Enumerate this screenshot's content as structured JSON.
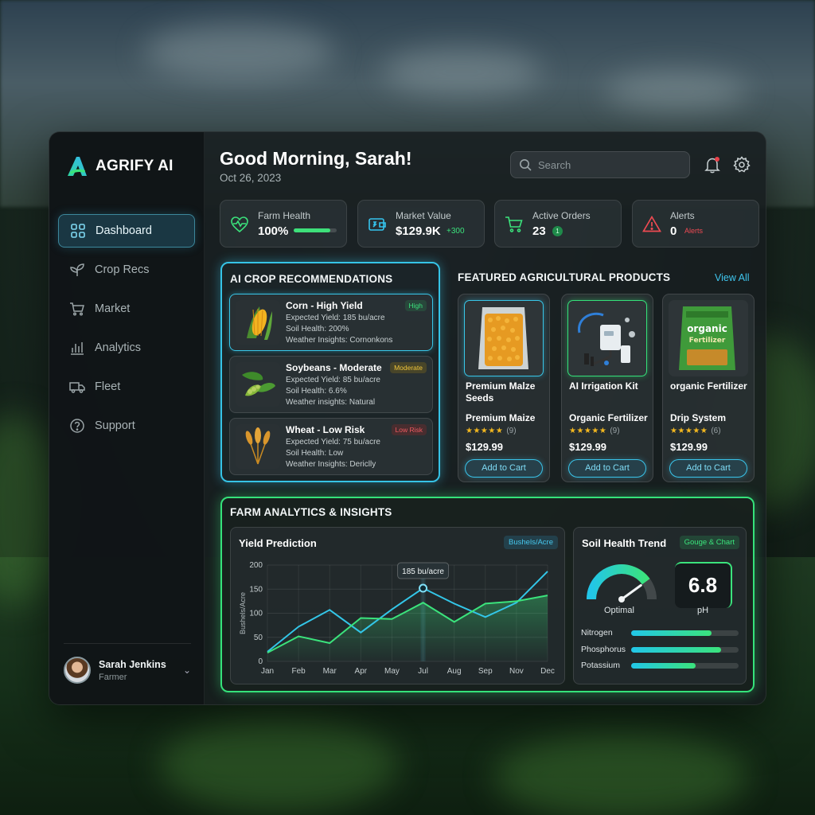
{
  "app": {
    "name": "AGRIFY AI"
  },
  "header": {
    "greeting": "Good Morning, Sarah!",
    "date": "Oct 26, 2023",
    "search_placeholder": "Search"
  },
  "sidebar": {
    "items": [
      {
        "label": "Dashboard",
        "icon": "grid-icon",
        "active": true
      },
      {
        "label": "Crop Recs",
        "icon": "sprout-icon"
      },
      {
        "label": "Market",
        "icon": "cart-icon"
      },
      {
        "label": "Analytics",
        "icon": "bar-chart-icon"
      },
      {
        "label": "Fleet",
        "icon": "truck-icon"
      },
      {
        "label": "Support",
        "icon": "help-icon"
      }
    ],
    "user": {
      "name": "Sarah Jenkins",
      "role": "Farmer"
    }
  },
  "stats": {
    "farm_health": {
      "label": "Farm Health",
      "value": "100%",
      "progress": 0.85
    },
    "market_value": {
      "label": "Market Value",
      "value": "$129.9K",
      "change": "+300"
    },
    "active_orders": {
      "label": "Active Orders",
      "value": "23",
      "badge": "1"
    },
    "alerts": {
      "label": "Alerts",
      "value": "0",
      "note": "Alerts"
    }
  },
  "ai_crops": {
    "title": "AI CROP RECOMMENDATIONS",
    "items": [
      {
        "name": "Corn - High Yield",
        "badge": "High",
        "yield": "Expected Yield: 185 bu/acre",
        "soil": "Soil Health: 200%",
        "weather": "Weather Insights: Cornonkons"
      },
      {
        "name": "Soybeans - Moderate",
        "badge": "Moderate",
        "yield": "Expected Yield: 85 bu/acre",
        "soil": "Soil Health: 6.6%",
        "weather": "Weather insights: Natural"
      },
      {
        "name": "Wheat - Low Risk",
        "badge": "Low Risk",
        "yield": "Expected Yield: 75 bu/acre",
        "soil": "Soil Health: Low",
        "weather": "Weather Insights: Dericlly"
      }
    ]
  },
  "products": {
    "title": "FEATURED AGRICULTURAL PRODUCTS",
    "view_all": "View All",
    "items": [
      {
        "name": "Premium Malze Seeds",
        "sub": "Premium Maize",
        "reviews": "(9)",
        "price": "$129.99",
        "button": "Add to Cart"
      },
      {
        "name": "AI Irrigation Kit",
        "sub": "Organic Fertilizer",
        "reviews": "(9)",
        "price": "$129.99",
        "button": "Add to Cart"
      },
      {
        "name": "organic Fertilizer",
        "sub": "Drip System",
        "reviews": "(6)",
        "price": "$129.99",
        "button": "Add to Cart",
        "bag_label_1": "organic",
        "bag_label_2": "Fertilizer"
      }
    ]
  },
  "analytics": {
    "title": "FARM ANALYTICS & INSIGHTS",
    "yield": {
      "title": "Yield Prediction",
      "tag": "Bushels/Acre",
      "tooltip": "185 bu/acre"
    },
    "soil": {
      "title": "Soil Health Trend",
      "tag": "Gouge & Chart",
      "gauge_label": "Optimal",
      "gauge_level": 0.8,
      "ph_value": "6.8",
      "ph_label": "pH",
      "nutrients": [
        {
          "name": "Nitrogen",
          "level": 0.75
        },
        {
          "name": "Phosphorus",
          "level": 0.84
        },
        {
          "name": "Potassium",
          "level": 0.6
        }
      ]
    }
  },
  "chart_data": {
    "type": "line",
    "categories": [
      "Jan",
      "Feb",
      "Mar",
      "Apr",
      "May",
      "Jul",
      "Aug",
      "Sep",
      "Nov",
      "Dec"
    ],
    "series": [
      {
        "values": [
          20,
          72,
          107,
          60,
          108,
          152,
          120,
          92,
          122,
          187
        ],
        "color": "#33c6e8"
      },
      {
        "values": [
          18,
          52,
          38,
          90,
          88,
          122,
          82,
          120,
          125,
          137
        ],
        "color": "#3be37c"
      }
    ],
    "ylabel": "Bushels/Acre",
    "ylim": [
      0,
      200
    ],
    "yticks": [
      "0",
      "50",
      "100",
      "150",
      "200"
    ],
    "highlight_index": 5,
    "grid": true
  }
}
